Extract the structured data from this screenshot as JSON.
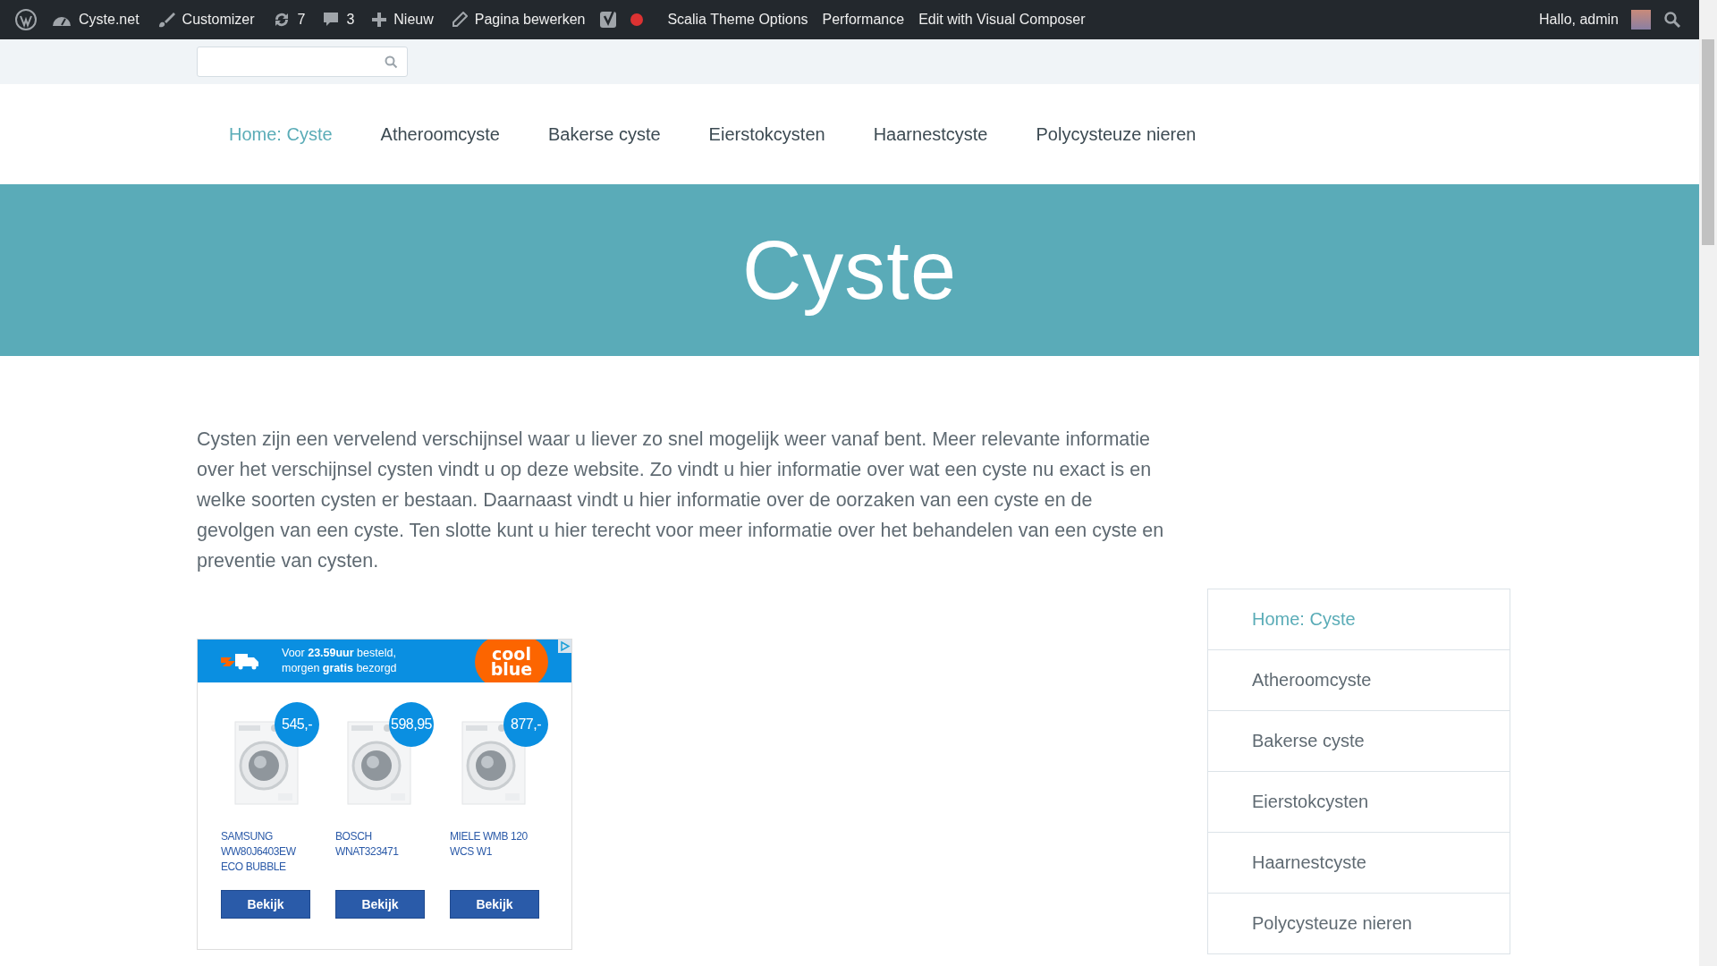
{
  "admin_bar": {
    "items": [
      {
        "kind": "wp"
      },
      {
        "kind": "dashboard",
        "label": "Cyste.net"
      },
      {
        "kind": "brush",
        "label": "Customizer"
      },
      {
        "kind": "updates",
        "label": "7"
      },
      {
        "kind": "comments",
        "label": "3"
      },
      {
        "kind": "plus",
        "label": "Nieuw"
      },
      {
        "kind": "pencil",
        "label": "Pagina bewerken"
      },
      {
        "kind": "yoast"
      },
      {
        "kind": "dot"
      },
      {
        "kind": "text",
        "label": "Scalia Theme Options"
      },
      {
        "kind": "text",
        "label": "Performance"
      },
      {
        "kind": "text",
        "label": "Edit with Visual Composer"
      }
    ],
    "greeting": "Hallo, admin"
  },
  "nav": [
    {
      "label": "Home: Cyste",
      "selected": true
    },
    {
      "label": "Atheroomcyste",
      "selected": false
    },
    {
      "label": "Bakerse cyste",
      "selected": false
    },
    {
      "label": "Eierstokcysten",
      "selected": false
    },
    {
      "label": "Haarnestcyste",
      "selected": false
    },
    {
      "label": "Polycysteuze nieren",
      "selected": false
    }
  ],
  "hero_title": "Cyste",
  "intro": "Cysten zijn een vervelend verschijnsel waar u liever zo snel mogelijk weer vanaf bent. Meer relevante informatie over het verschijnsel cysten vindt u op deze website. Zo vindt u hier informatie over wat een cyste nu exact is en welke soorten cysten er bestaan. Daarnaast vindt u hier informatie over de oorzaken van een cyste en de gevolgen van een cyste. Ten slotte kunt u hier terecht voor meer informatie over het behandelen van een cyste en preventie van cysten.",
  "ad": {
    "banner_line1": "Voor **23.59uur** besteld,",
    "banner_line2": "morgen **gratis** bezorgd",
    "logo_line1": "cool",
    "logo_line2": "blue",
    "products": [
      {
        "price": "545,-",
        "name": "SAMSUNG WW80J6403EW ECO BUBBLE",
        "button": "Bekijk"
      },
      {
        "price": "598,95",
        "name": "BOSCH WNAT323471",
        "button": "Bekijk"
      },
      {
        "price": "877,-",
        "name": "MIELE WMB 120 WCS W1",
        "button": "Bekijk"
      }
    ]
  },
  "sidebar": [
    {
      "label": "Home: Cyste",
      "selected": true
    },
    {
      "label": "Atheroomcyste",
      "selected": false
    },
    {
      "label": "Bakerse cyste",
      "selected": false
    },
    {
      "label": "Eierstokcysten",
      "selected": false
    },
    {
      "label": "Haarnestcyste",
      "selected": false
    },
    {
      "label": "Polycysteuze nieren",
      "selected": false
    }
  ]
}
